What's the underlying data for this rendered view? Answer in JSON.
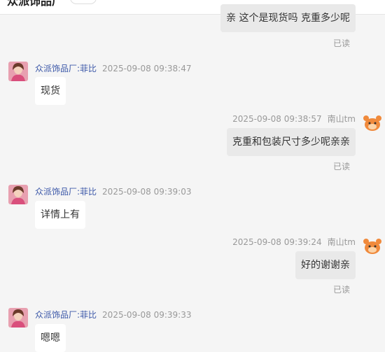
{
  "header": {
    "title": "众派饰品厂"
  },
  "messages": [
    {
      "direction": "out",
      "text": "亲 这个是现货吗 克重多少呢",
      "status": "已读"
    },
    {
      "direction": "in",
      "sender": "众派饰品厂:菲比",
      "time": "2025-09-08 09:38:47",
      "text": "现货"
    },
    {
      "direction": "out",
      "sender": "南山tm",
      "time": "2025-09-08 09:38:57",
      "text": "克重和包装尺寸多少呢亲亲",
      "status": "已读"
    },
    {
      "direction": "in",
      "sender": "众派饰品厂:菲比",
      "time": "2025-09-08 09:39:03",
      "text": "详情上有"
    },
    {
      "direction": "out",
      "sender": "南山tm",
      "time": "2025-09-08 09:39:24",
      "text": "好的谢谢亲",
      "status": "已读"
    },
    {
      "direction": "in",
      "sender": "众派饰品厂:菲比",
      "time": "2025-09-08 09:39:33",
      "text": "嗯嗯"
    }
  ],
  "icons": {
    "seller_avatar": "woman-avatar",
    "buyer_avatar": "cartoon-cat-avatar"
  },
  "colors": {
    "sender_name": "#3b57a8",
    "incoming_bubble": "#ffffff",
    "outgoing_bubble": "#e9e9e9",
    "background": "#f5f5f5"
  }
}
